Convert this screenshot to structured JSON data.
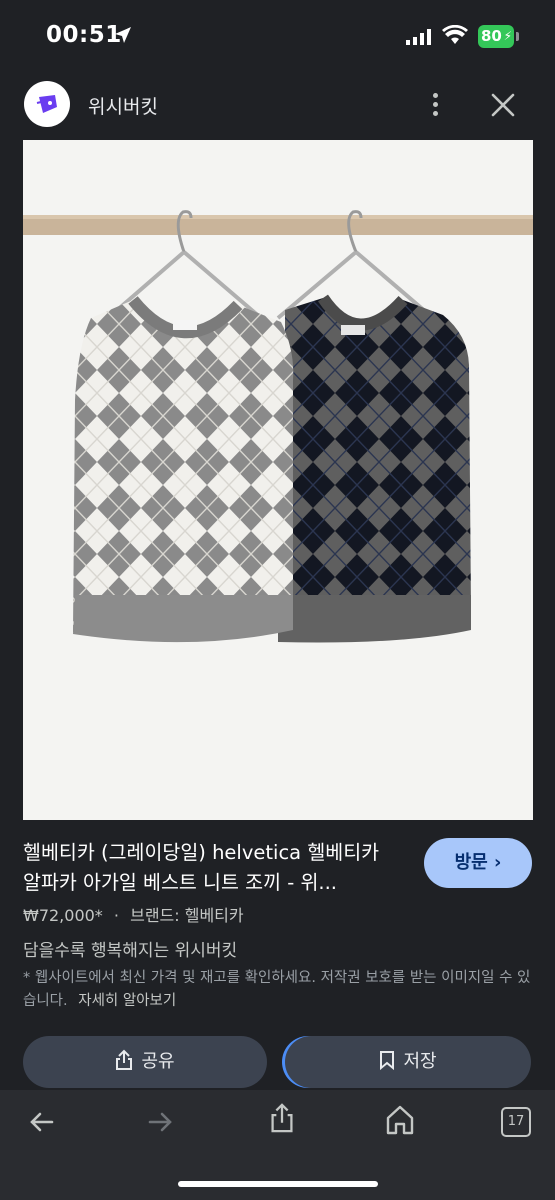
{
  "status": {
    "time": "00:51",
    "battery": "80"
  },
  "header": {
    "site_name": "위시버킷"
  },
  "product": {
    "title": "헬베티카 (그레이당일) helvetica 헬베티카 알파카 아가일 베스트 니트 조끼 - 위...",
    "price": "₩72,000*",
    "separator": "·",
    "brand": "브랜드: 헬베티카",
    "tagline": "담을수록 행복해지는 위시버킷",
    "notice": "* 웹사이트에서 최신 가격 및 재고를 확인하세요. 저작권 보호를 받는 이미지일 수 있습니다.",
    "learn_more": "자세히 알아보기"
  },
  "buttons": {
    "visit": "방문",
    "share": "공유",
    "save": "저장"
  },
  "toolbar": {
    "tab_count": "17"
  },
  "colors": {
    "accent": "#a8c7fa",
    "background": "#1f2125",
    "button": "#3c4350"
  },
  "icons": [
    "location-arrow-icon",
    "signal-icon",
    "wifi-icon",
    "more-icon",
    "close-icon",
    "lens-icon",
    "share-icon",
    "bookmark-icon",
    "back-icon",
    "forward-icon",
    "home-icon",
    "tabs-icon"
  ]
}
